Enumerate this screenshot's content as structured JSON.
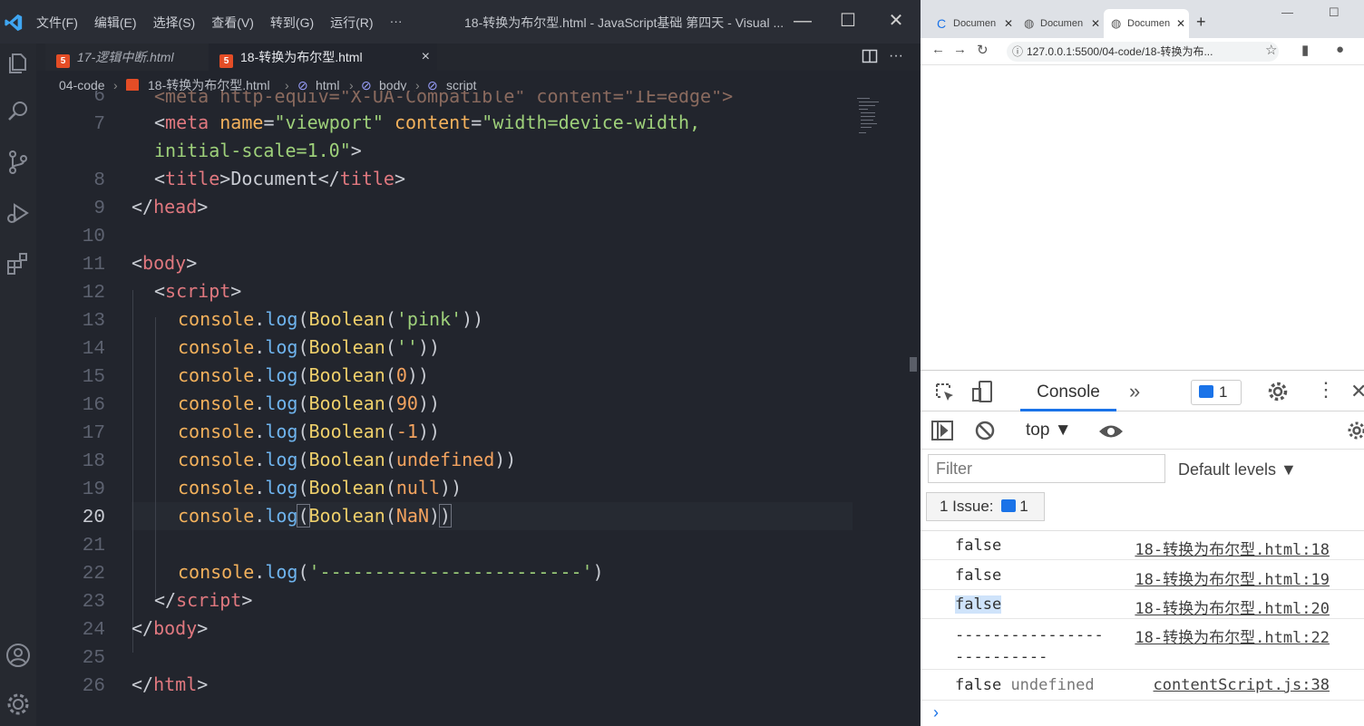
{
  "vscode": {
    "menu": [
      "文件(F)",
      "编辑(E)",
      "选择(S)",
      "查看(V)",
      "转到(G)",
      "运行(R)",
      "···"
    ],
    "window_title": "18-转换为布尔型.html - JavaScript基础 第四天 - Visual ...",
    "tabs": [
      {
        "label": "17-逻辑中断.html",
        "active": false
      },
      {
        "label": "18-转换为布尔型.html",
        "active": true
      }
    ],
    "tab_close": "×",
    "more": "···",
    "breadcrumb": [
      "04-code",
      "18-转换为布尔型.html",
      "html",
      "body",
      "script"
    ],
    "line_numbers": [
      "6",
      "7",
      "",
      "8",
      "9",
      "10",
      "11",
      "12",
      "13",
      "14",
      "15",
      "16",
      "17",
      "18",
      "19",
      "20",
      "21",
      "22",
      "23",
      "24",
      "25",
      "26"
    ],
    "active_line": "20",
    "code": {
      "l6": "<meta http-equiv=\"X-UA-Compatible\" content=\"IE=edge\">",
      "l7_meta": "meta",
      "l7_name": "name",
      "l7_name_val": "\"viewport\"",
      "l7_content": "content",
      "l7_content_val": "\"width=device-width,",
      "l7_cont": "initial-scale=1.0\"",
      "l8_title": "title",
      "l8_text": "Document",
      "l9_head": "head",
      "l11_body": "body",
      "l12_script": "script",
      "console": "console",
      "log": "log",
      "Boolean": "Boolean",
      "args": [
        "'pink'",
        "''",
        "0",
        "90",
        "-1",
        "undefined",
        "null",
        "NaN"
      ],
      "l22_str": "'------------------------'",
      "l23_script": "script",
      "l24_body": "body",
      "l26_html": "html"
    }
  },
  "browser": {
    "tabs": [
      "Documen",
      "Documen",
      "Documen"
    ],
    "new_tab": "+",
    "url": "127.0.0.1:5500/04-code/18-转换为布...",
    "devtools": {
      "console_tab": "Console",
      "overflow": "»",
      "issue_count": "1",
      "context": "top ▼",
      "filter_placeholder": "Filter",
      "levels": "Default levels ▼",
      "issues_button": "1 Issue:",
      "issues_button_count": "1",
      "rows": [
        {
          "msg": "false",
          "src": "18-转换为布尔型.html:18"
        },
        {
          "msg": "false",
          "src": "18-转换为布尔型.html:19"
        },
        {
          "msg": "false",
          "src": "18-转换为布尔型.html:20"
        },
        {
          "msg": "----------------\n----------",
          "src": "18-转换为布尔型.html:22"
        },
        {
          "msg": "false",
          "msg2": "undefined",
          "src": "contentScript.js:38"
        }
      ],
      "prompt": "›"
    }
  },
  "colors": {
    "editor_bg": "#22252d",
    "tag": "#e0787f",
    "attr": "#f3b15c",
    "string": "#9ed07a",
    "function": "#6fb4ee",
    "class": "#eecf6a",
    "accent": "#1a73e8"
  },
  "icons": [
    "vscode-logo-icon",
    "explorer-icon",
    "search-icon",
    "source-control-icon",
    "run-debug-icon",
    "extensions-icon",
    "account-icon",
    "settings-gear-icon",
    "html5-file-icon",
    "split-editor-icon",
    "inspect-icon",
    "device-toolbar-icon",
    "clear-console-icon",
    "sidebar-toggle-icon",
    "eye-icon",
    "gear-icon",
    "kebab-icon",
    "close-icon"
  ]
}
